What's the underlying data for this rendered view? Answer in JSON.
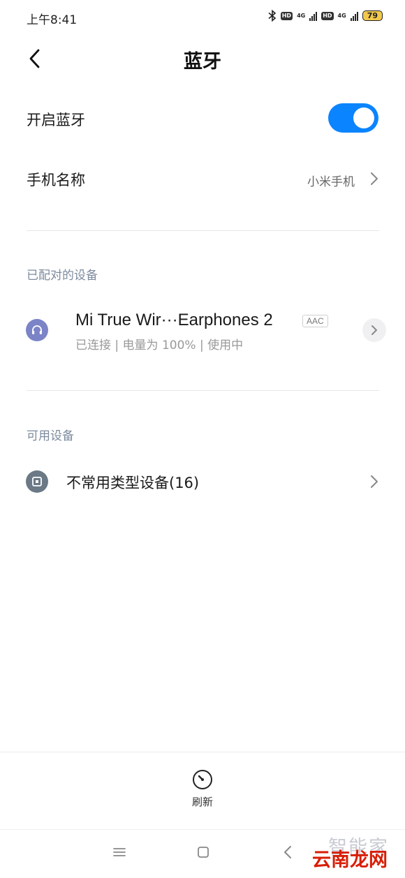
{
  "status_bar": {
    "time": "上午8:41",
    "hd1": "HD",
    "net1": "4G",
    "hd2": "HD",
    "net2": "4G",
    "battery": "79"
  },
  "header": {
    "title": "蓝牙"
  },
  "bluetooth_toggle": {
    "label": "开启蓝牙",
    "on": true
  },
  "device_name_row": {
    "label": "手机名称",
    "value": "小米手机"
  },
  "paired_section": {
    "title": "已配对的设备",
    "devices": [
      {
        "name": "Mi True Wir···Earphones 2",
        "codec": "AAC",
        "status": "已连接 | 电量为 100% | 使用中"
      }
    ]
  },
  "available_section": {
    "title": "可用设备",
    "items": [
      {
        "label": "不常用类型设备(16)"
      }
    ]
  },
  "bottom_action": {
    "label": "刷新"
  },
  "watermark": {
    "top": "智能家",
    "bottom": "云南龙网"
  },
  "colors": {
    "accent": "#0a84ff",
    "section_header": "#7d8a9e",
    "watermark_red": "#d81e06"
  }
}
